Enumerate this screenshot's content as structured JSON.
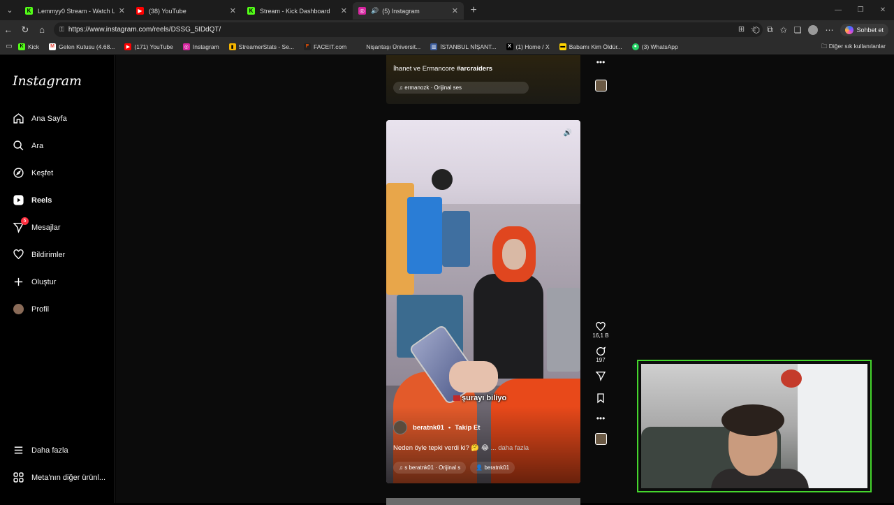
{
  "browser": {
    "tabs": [
      {
        "title": "Lemmyy0 Stream - Watch Live on",
        "icon_color": "#53fc18",
        "icon_letter": "K"
      },
      {
        "title": "(38) YouTube",
        "icon_color": "#ff0000",
        "icon_letter": "▶"
      },
      {
        "title": "Stream - Kick Dashboard",
        "icon_color": "#53fc18",
        "icon_letter": "K"
      },
      {
        "title": "(5) Instagram",
        "icon_color": "#d6249f",
        "icon_letter": "◎",
        "active": true
      }
    ],
    "url": "https://www.instagram.com/reels/DSSG_5IDdQT/",
    "copilot_label": "Sohbet et",
    "bookmarks": [
      {
        "label": "Kick",
        "icon_color": "#53fc18",
        "icon_letter": "K"
      },
      {
        "label": "Gelen Kutusu (4.68...",
        "icon_color": "#ea4335",
        "icon_letter": "M"
      },
      {
        "label": "(171) YouTube",
        "icon_color": "#ff0000",
        "icon_letter": "▶"
      },
      {
        "label": "Instagram",
        "icon_color": "#d6249f",
        "icon_letter": "◎"
      },
      {
        "label": "StreamerStats - Se...",
        "icon_color": "#f4b400",
        "icon_letter": "▮"
      },
      {
        "label": "FACEIT.com",
        "icon_color": "#ff5500",
        "icon_letter": "F"
      },
      {
        "label": "Nişantaşı Üniversit...",
        "icon_color": "#2c2c2c",
        "icon_letter": ""
      },
      {
        "label": "İSTANBUL NİŞANT...",
        "icon_color": "#3b5b9a",
        "icon_letter": "▥"
      },
      {
        "label": "(1) Home / X",
        "icon_color": "#000000",
        "icon_letter": "X"
      },
      {
        "label": "Babamı Kim Öldür...",
        "icon_color": "#ffd400",
        "icon_letter": "▬"
      },
      {
        "label": "(3) WhatsApp",
        "icon_color": "#25d366",
        "icon_letter": "●"
      }
    ],
    "bookmarks_other": "Diğer sık kullanılanlar"
  },
  "sidebar": {
    "logo": "Instagram",
    "items": [
      {
        "label": "Ana Sayfa",
        "icon": "home-icon"
      },
      {
        "label": "Ara",
        "icon": "search-icon"
      },
      {
        "label": "Keşfet",
        "icon": "compass-icon"
      },
      {
        "label": "Reels",
        "icon": "reels-icon",
        "active": true
      },
      {
        "label": "Mesajlar",
        "icon": "messenger-icon",
        "badge": "5"
      },
      {
        "label": "Bildirimler",
        "icon": "heart-icon"
      },
      {
        "label": "Oluştur",
        "icon": "plus-icon"
      },
      {
        "label": "Profil",
        "icon": "avatar-icon"
      }
    ],
    "more": "Daha fazla",
    "meta": "Meta'nın diğer ürünl..."
  },
  "previous_reel": {
    "caption_text": "İhanet ve Ermancore ",
    "caption_tag": "#arcraiders",
    "audio": "ermanozk · Orijinal ses"
  },
  "reel": {
    "subtitle": "şurayı biliyo",
    "author": "beratnk01",
    "follow": "Takip Et",
    "caption": "Neden öyle tepki verdi ki? 🤔 😂",
    "more": "... daha fazla",
    "audio": "s  beratnk01 · Orijinal s",
    "tagged": "beratnk01",
    "likes": "16,1 B",
    "comments": "197"
  }
}
